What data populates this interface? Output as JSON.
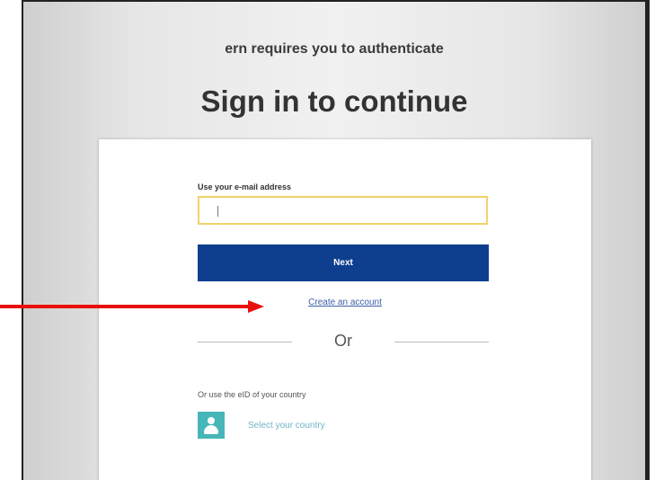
{
  "header": {
    "subtitle": "ern requires you to authenticate",
    "title": "Sign in to continue"
  },
  "form": {
    "email_label": "Use your e-mail address",
    "email_value": "",
    "next_label": "Next",
    "create_account_link": "Create an account",
    "separator_text": "Or",
    "eid_label": "Or use the eID of your country",
    "select_country_label": "Select your country"
  },
  "colors": {
    "next_button": "#0e3e8e",
    "input_border": "#f2d36a",
    "country_icon": "#47b6b8",
    "arrow": "#e8100b"
  },
  "icons": {
    "country": "person-icon",
    "annotation": "red-arrow-icon"
  }
}
